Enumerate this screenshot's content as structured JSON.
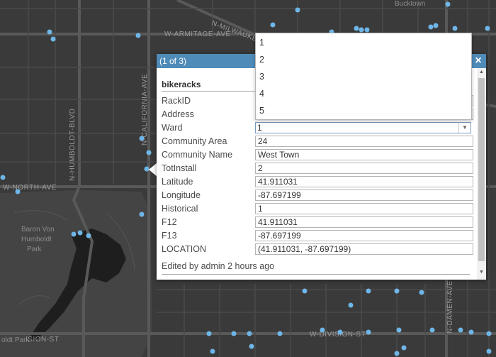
{
  "map": {
    "street_labels": {
      "milwaukee": "N-MILWAUKEE",
      "armitage": "W-ARMITAGE-AVE",
      "humboldt_blvd": "N-HUMBOLDT-BLVD",
      "california": "N-CALIFORNIA-AVE",
      "north_ave": "W-NORTH-AVE",
      "division": "W-DIVISION-ST",
      "division_left": "ISION-ST",
      "damen": "N-DAMEN-AVE"
    },
    "place_labels": {
      "bucktown": "Bucktown",
      "park_line1": "Baron Von",
      "park_line2": "Humboldt",
      "park_line3": "Park",
      "humboldt_park": "oldt Park"
    },
    "colors": {
      "background": "#3b3b3b",
      "road": "#555555",
      "point": "#6fb6e8"
    }
  },
  "popup": {
    "counter": "(1 of 3)",
    "close_icon": "×",
    "layer_title": "bikeracks",
    "fields": [
      {
        "label": "RackID",
        "value": ""
      },
      {
        "label": "Address",
        "value": ""
      },
      {
        "label": "Ward",
        "value": "1"
      },
      {
        "label": "Community Area",
        "value": "24"
      },
      {
        "label": "Community Name",
        "value": "West Town"
      },
      {
        "label": "TotInstall",
        "value": "2"
      },
      {
        "label": "Latitude",
        "value": "41.911031"
      },
      {
        "label": "Longitude",
        "value": "-87.697199"
      },
      {
        "label": "Historical",
        "value": "1"
      },
      {
        "label": "F12",
        "value": "41.911031"
      },
      {
        "label": "F13",
        "value": "-87.697199"
      },
      {
        "label": "LOCATION",
        "value": "(41.911031, -87.697199)"
      }
    ],
    "footer": "Edited by admin 2 hours ago",
    "header_color": "#4f8bb9"
  },
  "dropdown": {
    "options": [
      "1",
      "2",
      "3",
      "4",
      "5"
    ]
  }
}
